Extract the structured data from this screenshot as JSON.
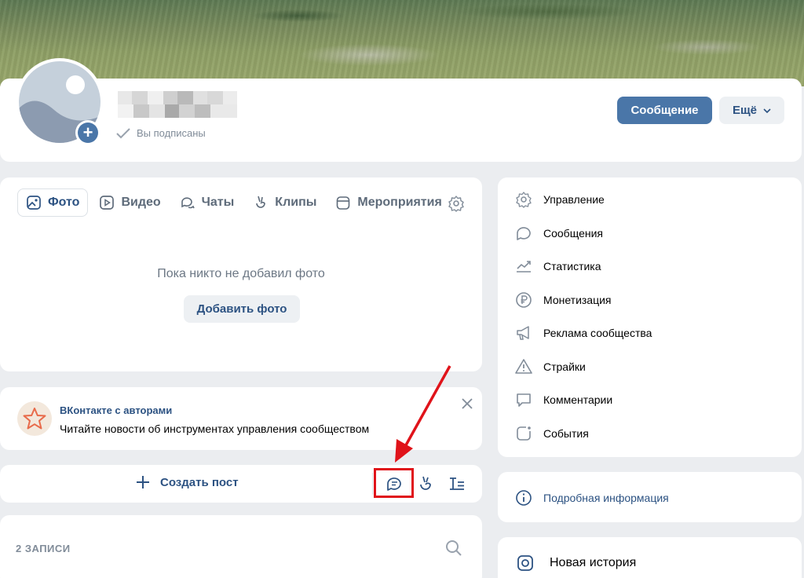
{
  "profile": {
    "status": "Вы подписаны",
    "message_button": "Сообщение",
    "more_button": "Ещё"
  },
  "media": {
    "tabs": [
      {
        "label": "Фото",
        "active": true,
        "icon": "photo-icon"
      },
      {
        "label": "Видео",
        "active": false,
        "icon": "video-icon"
      },
      {
        "label": "Чаты",
        "active": false,
        "icon": "chats-icon"
      },
      {
        "label": "Клипы",
        "active": false,
        "icon": "clips-icon"
      },
      {
        "label": "Мероприятия",
        "active": false,
        "icon": "calendar-icon"
      }
    ],
    "empty_text": "Пока никто не добавил фото",
    "add_photo_button": "Добавить фото"
  },
  "promo": {
    "title": "ВКонтакте с авторами",
    "text": "Читайте новости об инструментах управления сообществом"
  },
  "create_post": {
    "label": "Создать пост"
  },
  "posts": {
    "count_label": "2 ЗАПИСИ"
  },
  "sidebar_menu": {
    "items": [
      {
        "label": "Управление",
        "icon": "gear-icon"
      },
      {
        "label": "Сообщения",
        "icon": "message-icon"
      },
      {
        "label": "Статистика",
        "icon": "chart-icon"
      },
      {
        "label": "Монетизация",
        "icon": "ruble-icon"
      },
      {
        "label": "Реклама сообщества",
        "icon": "megaphone-icon"
      },
      {
        "label": "Страйки",
        "icon": "warning-icon"
      },
      {
        "label": "Комментарии",
        "icon": "comment-icon"
      },
      {
        "label": "События",
        "icon": "events-icon"
      }
    ]
  },
  "info": {
    "label": "Подробная информация"
  },
  "story": {
    "label": "Новая история"
  },
  "colors": {
    "accent": "#4a76a8",
    "link": "#2c5282",
    "highlight": "#e0131a"
  }
}
